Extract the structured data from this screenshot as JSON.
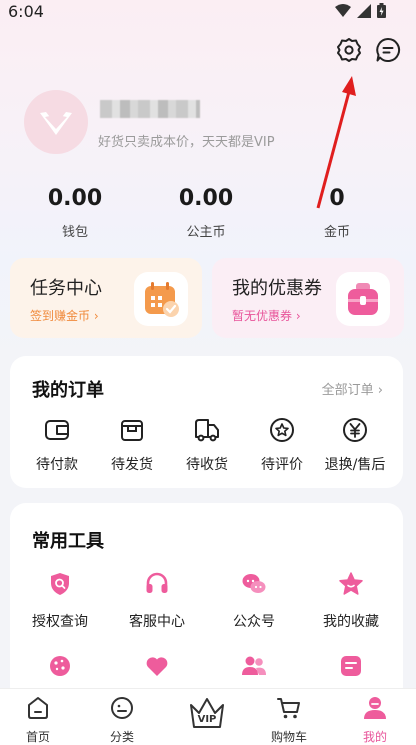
{
  "status_bar": {
    "time": "6:04"
  },
  "profile": {
    "slogan": "好货只卖成本价，天天都是VIP"
  },
  "stats": [
    {
      "value": "0.00",
      "label": "钱包"
    },
    {
      "value": "0.00",
      "label": "公主币"
    },
    {
      "value": "0",
      "label": "金币"
    }
  ],
  "promos": {
    "tasks": {
      "title": "任务中心",
      "sub": "签到赚金币 ›",
      "sub_color": "#f08a3c"
    },
    "coupons": {
      "title": "我的优惠券",
      "sub": "暂无优惠券 ›",
      "sub_color": "#e8549a"
    }
  },
  "orders": {
    "title": "我的订单",
    "more": "全部订单 ›",
    "items": [
      {
        "label": "待付款",
        "icon": "wallet-icon"
      },
      {
        "label": "待发货",
        "icon": "box-icon"
      },
      {
        "label": "待收货",
        "icon": "truck-icon"
      },
      {
        "label": "待评价",
        "icon": "review-icon"
      },
      {
        "label": "退换/售后",
        "icon": "refund-icon"
      }
    ]
  },
  "tools": {
    "title": "常用工具",
    "items": [
      {
        "label": "授权查询",
        "icon": "shield-search-icon"
      },
      {
        "label": "客服中心",
        "icon": "headset-icon"
      },
      {
        "label": "公众号",
        "icon": "chat-bubbles-icon"
      },
      {
        "label": "我的收藏",
        "icon": "star-icon"
      }
    ]
  },
  "nav": [
    {
      "label": "首页",
      "icon": "home-icon"
    },
    {
      "label": "分类",
      "icon": "category-icon"
    },
    {
      "label": "VIP",
      "icon": "vip-crown-icon"
    },
    {
      "label": "购物车",
      "icon": "cart-icon"
    },
    {
      "label": "我的",
      "icon": "profile-icon",
      "active": true
    }
  ],
  "colors": {
    "accent": "#e8549a",
    "orange": "#f08a3c"
  }
}
